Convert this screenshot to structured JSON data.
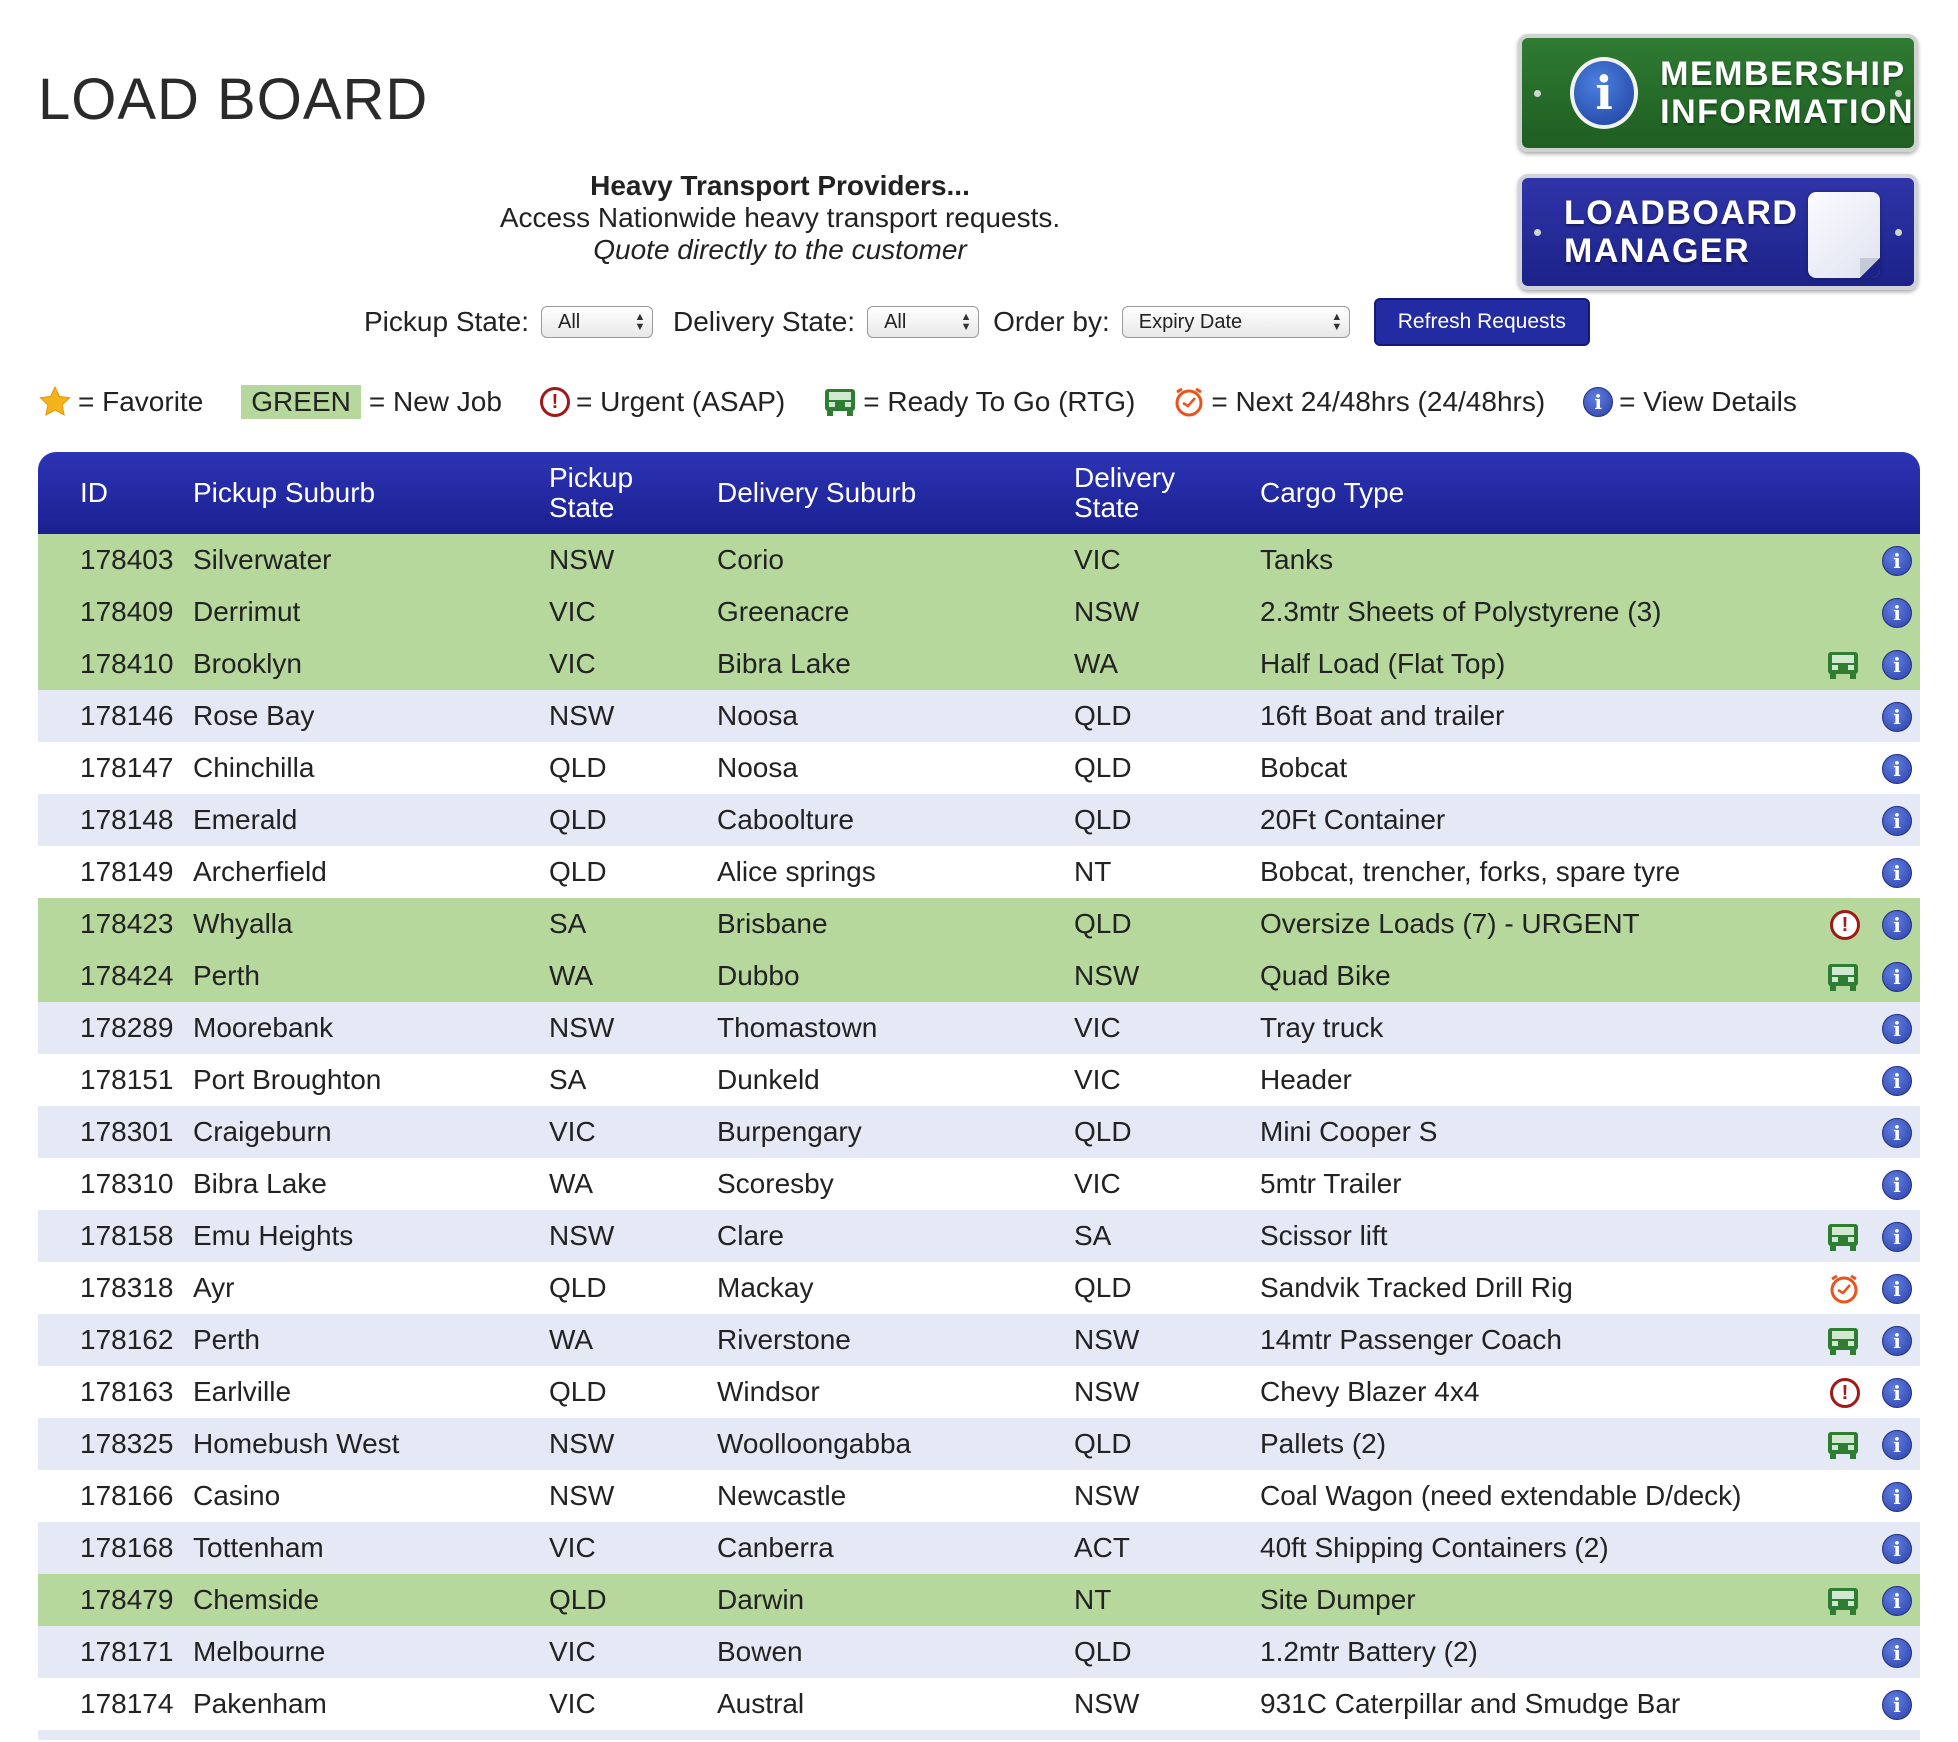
{
  "page": {
    "title": "LOAD BOARD"
  },
  "promos": {
    "membership_line1": "MEMBERSHIP",
    "membership_line2": "INFORMATION",
    "loadboard_line1": "LOADBOARD",
    "loadboard_line2": "MANAGER"
  },
  "intro": {
    "heading": "Heavy Transport Providers...",
    "line1": "Access Nationwide heavy transport requests.",
    "line2": "Quote directly to the customer"
  },
  "filters": {
    "pickup_label": "Pickup State:",
    "pickup_value": "All",
    "delivery_label": "Delivery State:",
    "delivery_value": "All",
    "order_label": "Order by:",
    "order_value": "Expiry Date",
    "refresh_label": "Refresh Requests"
  },
  "legend": {
    "favorite": "= Favorite",
    "green_chip": "GREEN",
    "new_job": "= New Job",
    "urgent": "= Urgent (ASAP)",
    "rtg": "= Ready To Go (RTG)",
    "next": "= Next 24/48hrs (24/48hrs)",
    "details": "= View Details"
  },
  "colors": {
    "header_blue": "#1f2699",
    "new_job_green": "#b6d89c",
    "alt_row": "#e5e8f5",
    "urgent_red": "#a01818",
    "rtg_green": "#2e7d32",
    "next_orange": "#e8541e"
  },
  "table": {
    "headers": {
      "id": "ID",
      "pickup_suburb": "Pickup Suburb",
      "pickup_state_1": "Pickup",
      "pickup_state_2": "State",
      "delivery_suburb": "Delivery Suburb",
      "delivery_state_1": "Delivery",
      "delivery_state_2": "State",
      "cargo": "Cargo Type"
    },
    "rows": [
      {
        "id": "178403",
        "pickup": "Silverwater",
        "pstate": "NSW",
        "delivery": "Corio",
        "dstate": "VIC",
        "cargo": "Tanks",
        "status": "new",
        "flag": ""
      },
      {
        "id": "178409",
        "pickup": "Derrimut",
        "pstate": "VIC",
        "delivery": "Greenacre",
        "dstate": "NSW",
        "cargo": "2.3mtr Sheets of Polystyrene (3)",
        "status": "new",
        "flag": ""
      },
      {
        "id": "178410",
        "pickup": "Brooklyn",
        "pstate": "VIC",
        "delivery": "Bibra Lake",
        "dstate": "WA",
        "cargo": "Half Load (Flat Top)",
        "status": "new",
        "flag": "rtg"
      },
      {
        "id": "178146",
        "pickup": "Rose Bay",
        "pstate": "NSW",
        "delivery": "Noosa",
        "dstate": "QLD",
        "cargo": "16ft Boat and trailer",
        "status": "alt",
        "flag": ""
      },
      {
        "id": "178147",
        "pickup": "Chinchilla",
        "pstate": "QLD",
        "delivery": "Noosa",
        "dstate": "QLD",
        "cargo": "Bobcat",
        "status": "plain",
        "flag": ""
      },
      {
        "id": "178148",
        "pickup": "Emerald",
        "pstate": "QLD",
        "delivery": "Caboolture",
        "dstate": "QLD",
        "cargo": "20Ft Container",
        "status": "alt",
        "flag": ""
      },
      {
        "id": "178149",
        "pickup": "Archerfield",
        "pstate": "QLD",
        "delivery": "Alice springs",
        "dstate": "NT",
        "cargo": "Bobcat, trencher, forks, spare tyre",
        "status": "plain",
        "flag": ""
      },
      {
        "id": "178423",
        "pickup": "Whyalla",
        "pstate": "SA",
        "delivery": "Brisbane",
        "dstate": "QLD",
        "cargo": "Oversize Loads (7) - URGENT",
        "status": "new",
        "flag": "urgent"
      },
      {
        "id": "178424",
        "pickup": "Perth",
        "pstate": "WA",
        "delivery": "Dubbo",
        "dstate": "NSW",
        "cargo": "Quad Bike",
        "status": "new",
        "flag": "rtg"
      },
      {
        "id": "178289",
        "pickup": "Moorebank",
        "pstate": "NSW",
        "delivery": "Thomastown",
        "dstate": "VIC",
        "cargo": "Tray truck",
        "status": "alt",
        "flag": ""
      },
      {
        "id": "178151",
        "pickup": "Port Broughton",
        "pstate": "SA",
        "delivery": "Dunkeld",
        "dstate": "VIC",
        "cargo": "Header",
        "status": "plain",
        "flag": ""
      },
      {
        "id": "178301",
        "pickup": "Craigeburn",
        "pstate": "VIC",
        "delivery": "Burpengary",
        "dstate": "QLD",
        "cargo": "Mini Cooper S",
        "status": "alt",
        "flag": ""
      },
      {
        "id": "178310",
        "pickup": "Bibra Lake",
        "pstate": "WA",
        "delivery": "Scoresby",
        "dstate": "VIC",
        "cargo": "5mtr Trailer",
        "status": "plain",
        "flag": ""
      },
      {
        "id": "178158",
        "pickup": "Emu Heights",
        "pstate": "NSW",
        "delivery": "Clare",
        "dstate": "SA",
        "cargo": "Scissor lift",
        "status": "alt",
        "flag": "rtg"
      },
      {
        "id": "178318",
        "pickup": "Ayr",
        "pstate": "QLD",
        "delivery": "Mackay",
        "dstate": "QLD",
        "cargo": "Sandvik Tracked Drill Rig",
        "status": "plain",
        "flag": "next"
      },
      {
        "id": "178162",
        "pickup": "Perth",
        "pstate": "WA",
        "delivery": "Riverstone",
        "dstate": "NSW",
        "cargo": "14mtr Passenger Coach",
        "status": "alt",
        "flag": "rtg"
      },
      {
        "id": "178163",
        "pickup": "Earlville",
        "pstate": "QLD",
        "delivery": "Windsor",
        "dstate": "NSW",
        "cargo": "Chevy Blazer 4x4",
        "status": "plain",
        "flag": "urgent"
      },
      {
        "id": "178325",
        "pickup": "Homebush West",
        "pstate": "NSW",
        "delivery": "Woolloongabba",
        "dstate": "QLD",
        "cargo": "Pallets (2)",
        "status": "alt",
        "flag": "rtg"
      },
      {
        "id": "178166",
        "pickup": "Casino",
        "pstate": "NSW",
        "delivery": "Newcastle",
        "dstate": "NSW",
        "cargo": "Coal Wagon (need extendable D/deck)",
        "status": "plain",
        "flag": ""
      },
      {
        "id": "178168",
        "pickup": "Tottenham",
        "pstate": "VIC",
        "delivery": "Canberra",
        "dstate": "ACT",
        "cargo": "40ft Shipping Containers (2)",
        "status": "alt",
        "flag": ""
      },
      {
        "id": "178479",
        "pickup": "Chemside",
        "pstate": "QLD",
        "delivery": "Darwin",
        "dstate": "NT",
        "cargo": "Site Dumper",
        "status": "new",
        "flag": "rtg"
      },
      {
        "id": "178171",
        "pickup": "Melbourne",
        "pstate": "VIC",
        "delivery": "Bowen",
        "dstate": "QLD",
        "cargo": "1.2mtr Battery (2)",
        "status": "alt",
        "flag": ""
      },
      {
        "id": "178174",
        "pickup": "Pakenham",
        "pstate": "VIC",
        "delivery": "Austral",
        "dstate": "NSW",
        "cargo": "931C Caterpillar and Smudge Bar",
        "status": "plain",
        "flag": ""
      }
    ]
  }
}
